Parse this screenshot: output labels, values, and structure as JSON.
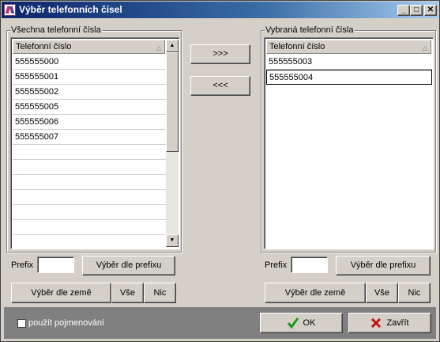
{
  "window": {
    "title": "Výběr telefonních čísel",
    "minimize": "_",
    "maximize": "□",
    "close": "✕"
  },
  "left": {
    "group_label": "Všechna telefonní čísla",
    "column_header": "Telefonní číslo",
    "rows": [
      "555555000",
      "555555001",
      "555555002",
      "555555005",
      "555555006",
      "555555007"
    ],
    "prefix_label": "Prefix",
    "prefix_value": "",
    "prefix_button": "Výběr dle prefixu",
    "country_button": "Výběr dle země",
    "all_button": "Vše",
    "none_button": "Nic"
  },
  "transfer": {
    "add": ">>>",
    "remove": "<<<"
  },
  "right": {
    "group_label": "Vybraná telefonní čísla",
    "column_header": "Telefonní číslo",
    "rows": [
      "555555003",
      "555555004"
    ],
    "prefix_label": "Prefix",
    "prefix_value": "",
    "prefix_button": "Výběr dle prefixu",
    "country_button": "Výběr dle země",
    "all_button": "Vše",
    "none_button": "Nic"
  },
  "footer": {
    "use_naming_label": "použít pojmenování",
    "use_naming_checked": false,
    "ok_button": "OK",
    "close_button": "Zavřít",
    "ok_color": "#1a9a1a",
    "close_color": "#c01010"
  }
}
